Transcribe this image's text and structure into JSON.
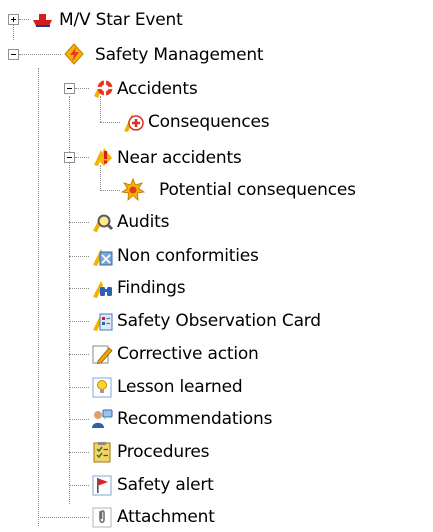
{
  "tree": {
    "nodes": [
      {
        "label": "M/V Star Event",
        "icon": "ship-icon",
        "expander": "plus"
      },
      {
        "label": "Safety Management",
        "icon": "lightning-shield-icon",
        "expander": "minus"
      },
      {
        "label": "Accidents",
        "icon": "lifebuoy-icon",
        "expander": "minus"
      },
      {
        "label": "Consequences",
        "icon": "first-aid-icon",
        "expander": null
      },
      {
        "label": "Near accidents",
        "icon": "warning-exclamation-icon",
        "expander": "minus"
      },
      {
        "label": "Potential consequences",
        "icon": "burst-warning-icon",
        "expander": null
      },
      {
        "label": "Audits",
        "icon": "magnifier-icon",
        "expander": null
      },
      {
        "label": "Non conformities",
        "icon": "document-cross-icon",
        "expander": null
      },
      {
        "label": "Findings",
        "icon": "binoculars-icon",
        "expander": null
      },
      {
        "label": "Safety Observation Card",
        "icon": "observation-card-icon",
        "expander": null
      },
      {
        "label": "Corrective action",
        "icon": "pencil-icon",
        "expander": null
      },
      {
        "label": "Lesson learned",
        "icon": "lightbulb-icon",
        "expander": null
      },
      {
        "label": "Recommendations",
        "icon": "person-speech-icon",
        "expander": null
      },
      {
        "label": "Procedures",
        "icon": "checklist-icon",
        "expander": null
      },
      {
        "label": "Safety alert",
        "icon": "red-flag-icon",
        "expander": null
      },
      {
        "label": "Attachment",
        "icon": "paperclip-icon",
        "expander": null
      }
    ]
  }
}
